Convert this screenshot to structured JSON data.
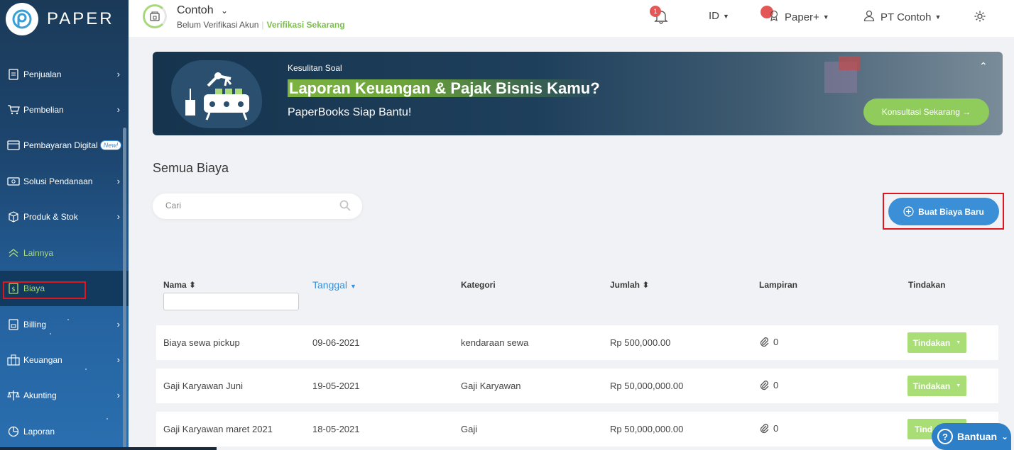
{
  "brand": {
    "name": "PAPER"
  },
  "sidebar": {
    "items": [
      {
        "label": "Penjualan",
        "icon": "document-icon"
      },
      {
        "label": "Pembelian",
        "icon": "cart-icon"
      },
      {
        "label": "Pembayaran Digital",
        "icon": "card-icon",
        "badge": "New!"
      },
      {
        "label": "Solusi Pendanaan",
        "icon": "cash-icon"
      },
      {
        "label": "Produk & Stok",
        "icon": "box-icon"
      },
      {
        "label": "Lainnya",
        "icon": "double-chevron-up-icon"
      },
      {
        "label": "Biaya",
        "icon": "receipt-icon"
      },
      {
        "label": "Billing",
        "icon": "billing-icon"
      },
      {
        "label": "Keuangan",
        "icon": "bank-icon"
      },
      {
        "label": "Akunting",
        "icon": "scale-icon"
      },
      {
        "label": "Laporan",
        "icon": "pie-chart-icon"
      }
    ]
  },
  "header": {
    "store_name": "Contoh",
    "store_status": "Belum Verifikasi Akun",
    "verify_link": "Verifikasi Sekarang",
    "notification_count": "1",
    "language": "ID",
    "plan": "Paper+",
    "company": "PT Contoh"
  },
  "banner": {
    "eyebrow": "Kesulitan Soal",
    "title": "Laporan Keuangan & Pajak Bisnis Kamu?",
    "subtitle": "PaperBooks Siap Bantu!",
    "cta": "Konsultasi Sekarang →"
  },
  "main": {
    "title": "Semua Biaya",
    "search_placeholder": "Cari",
    "new_button": "Buat Biaya Baru",
    "columns": {
      "nama": "Nama",
      "tanggal": "Tanggal",
      "kategori": "Kategori",
      "jumlah": "Jumlah",
      "lampiran": "Lampiran",
      "tindakan": "Tindakan"
    },
    "rows": [
      {
        "nama": "Biaya sewa pickup",
        "tanggal": "09-06-2021",
        "kategori": "kendaraan sewa",
        "jumlah": "Rp 500,000.00",
        "lampiran": "0",
        "action": "Tindakan"
      },
      {
        "nama": "Gaji Karyawan Juni",
        "tanggal": "19-05-2021",
        "kategori": "Gaji Karyawan",
        "jumlah": "Rp 50,000,000.00",
        "lampiran": "0",
        "action": "Tindakan"
      },
      {
        "nama": "Gaji Karyawan maret 2021",
        "tanggal": "18-05-2021",
        "kategori": "Gaji",
        "jumlah": "Rp 50,000,000.00",
        "lampiran": "0",
        "action": "Tind"
      }
    ]
  },
  "help": {
    "label": "Bantuan"
  },
  "colors": {
    "accent_green": "#8fcc5c",
    "primary_blue": "#3b8fd6",
    "highlight_red": "#e0161c"
  }
}
